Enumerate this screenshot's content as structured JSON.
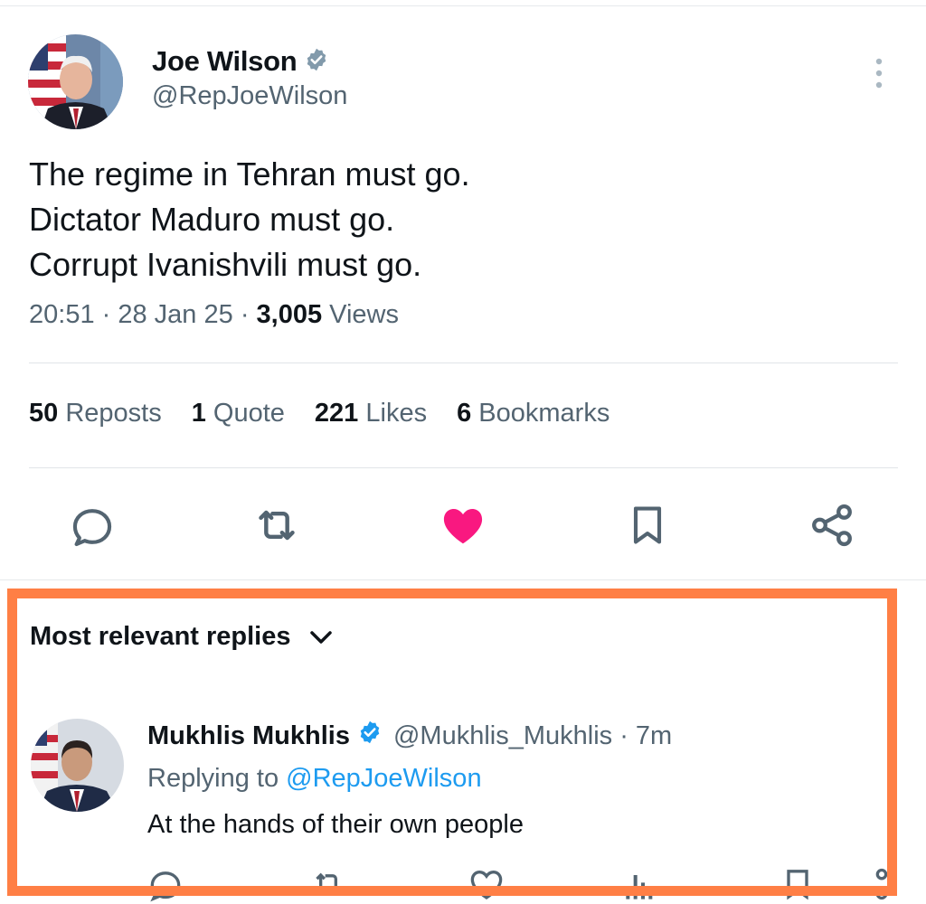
{
  "tweet": {
    "author": {
      "name": "Joe Wilson",
      "handle": "@RepJoeWilson",
      "verified": true,
      "avatar_icon": "profile-photo-flag"
    },
    "text_lines": [
      "The regime in Tehran must go.",
      "Dictator Maduro must go.",
      "Corrupt Ivanishvili must go."
    ],
    "time": "20:51",
    "date": "28 Jan 25",
    "views_count": "3,005",
    "views_label": "Views",
    "stats": {
      "reposts": {
        "count": "50",
        "label": "Reposts"
      },
      "quotes": {
        "count": "1",
        "label": "Quote"
      },
      "likes": {
        "count": "221",
        "label": "Likes"
      },
      "bookmarks": {
        "count": "6",
        "label": "Bookmarks"
      }
    },
    "actions": [
      "reply-icon",
      "retweet-icon",
      "like-icon-filled",
      "bookmark-icon",
      "share-icon"
    ],
    "liked": true,
    "like_color": "#f91880"
  },
  "replies": {
    "sort_label": "Most relevant replies",
    "items": [
      {
        "name": "Mukhlis Mukhlis",
        "handle": "@Mukhlis_Mukhlis",
        "time": "· 7m",
        "verified": true,
        "replying_prefix": "Replying to",
        "replying_to": "@RepJoeWilson",
        "text": "At the hands of their own people"
      }
    ]
  },
  "colors": {
    "highlight_border": "#ff7f45",
    "verified_main": "#829aab",
    "verified_reply": "#1d9bf0",
    "secondary_text": "#536471"
  }
}
